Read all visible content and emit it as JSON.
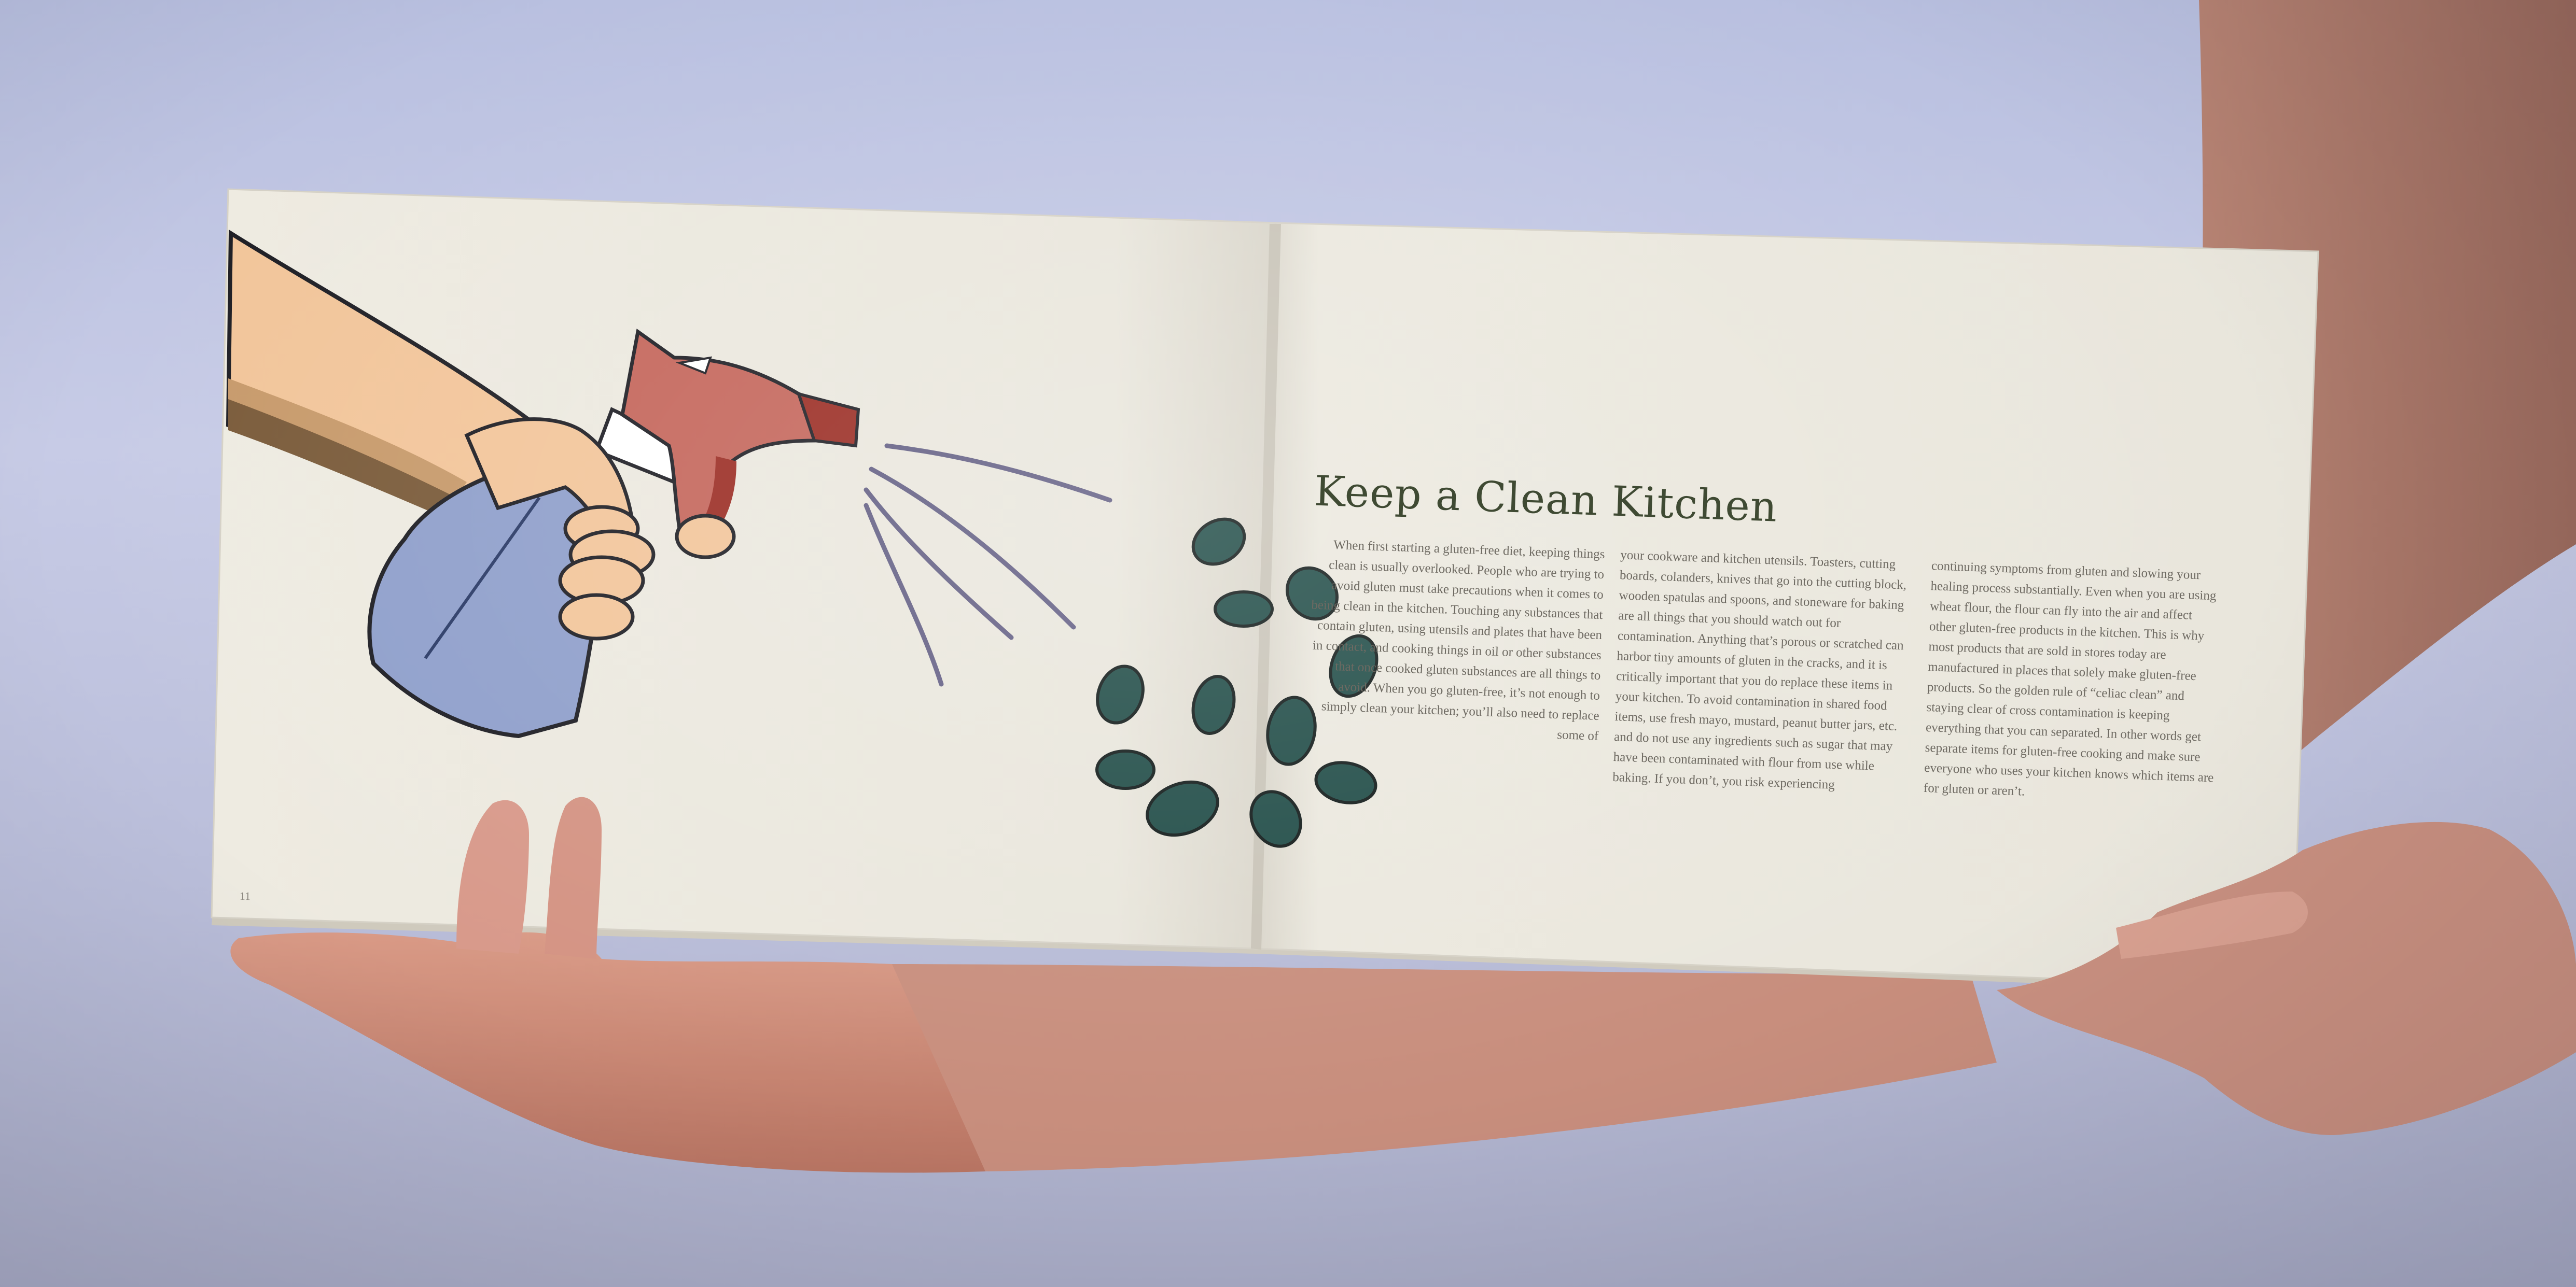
{
  "book": {
    "page_number": "11",
    "title": "Keep a Clean Kitchen",
    "columns": [
      "When first starting a gluten-free diet, keeping things clean is usually overlooked. People who are trying to avoid gluten must take precautions when it comes to being clean in the kitchen. Touching any substances that contain gluten, using utensils and plates that have been in contact, and cooking things in oil or other substances that once cooked gluten substances are all things to avoid. When you go gluten-free, it’s not enough to simply clean your kitchen; you’ll also need to replace some of",
      "your cookware and kitchen utensils. Toasters, cutting boards, colanders, knives that go into the cutting block, wooden spatulas and spoons, and stoneware for baking are all things that you should watch out for contamination. Anything that’s porous or scratched can harbor tiny amounts of gluten in the cracks, and it is critically important that you do replace these items in your kitchen. To avoid contamination in shared food items, use fresh mayo, mustard, peanut butter jars, etc. and do not use any ingredients such as sugar that may have been contaminated with flour from use while baking. If you don’t, you risk experiencing",
      "continuing symptoms from gluten and slowing your healing process substantially. Even when you are using wheat flour, the flour can fly into the air and affect other gluten-free products in the kitchen. This is why most products that are sold in stores today are manufactured in places that solely make gluten-free products. So the golden rule of “celiac clean” and staying clear of cross contamination is keeping everything that you can separated. In other words get separate items for gluten-free cooking and make sure everyone who uses your kitchen knows which items are for gluten or aren’t."
    ]
  },
  "colors": {
    "background": "#c3c8e4",
    "page": "#ece9df",
    "title": "#3f4a33",
    "body_text": "#6e6a62",
    "spray_bottle": "#c4655a",
    "nozzle": "#9a2b22",
    "bottle_body": "#8f9fcb",
    "spray_lines": "#54507a",
    "droplets": "#1f4b46"
  }
}
